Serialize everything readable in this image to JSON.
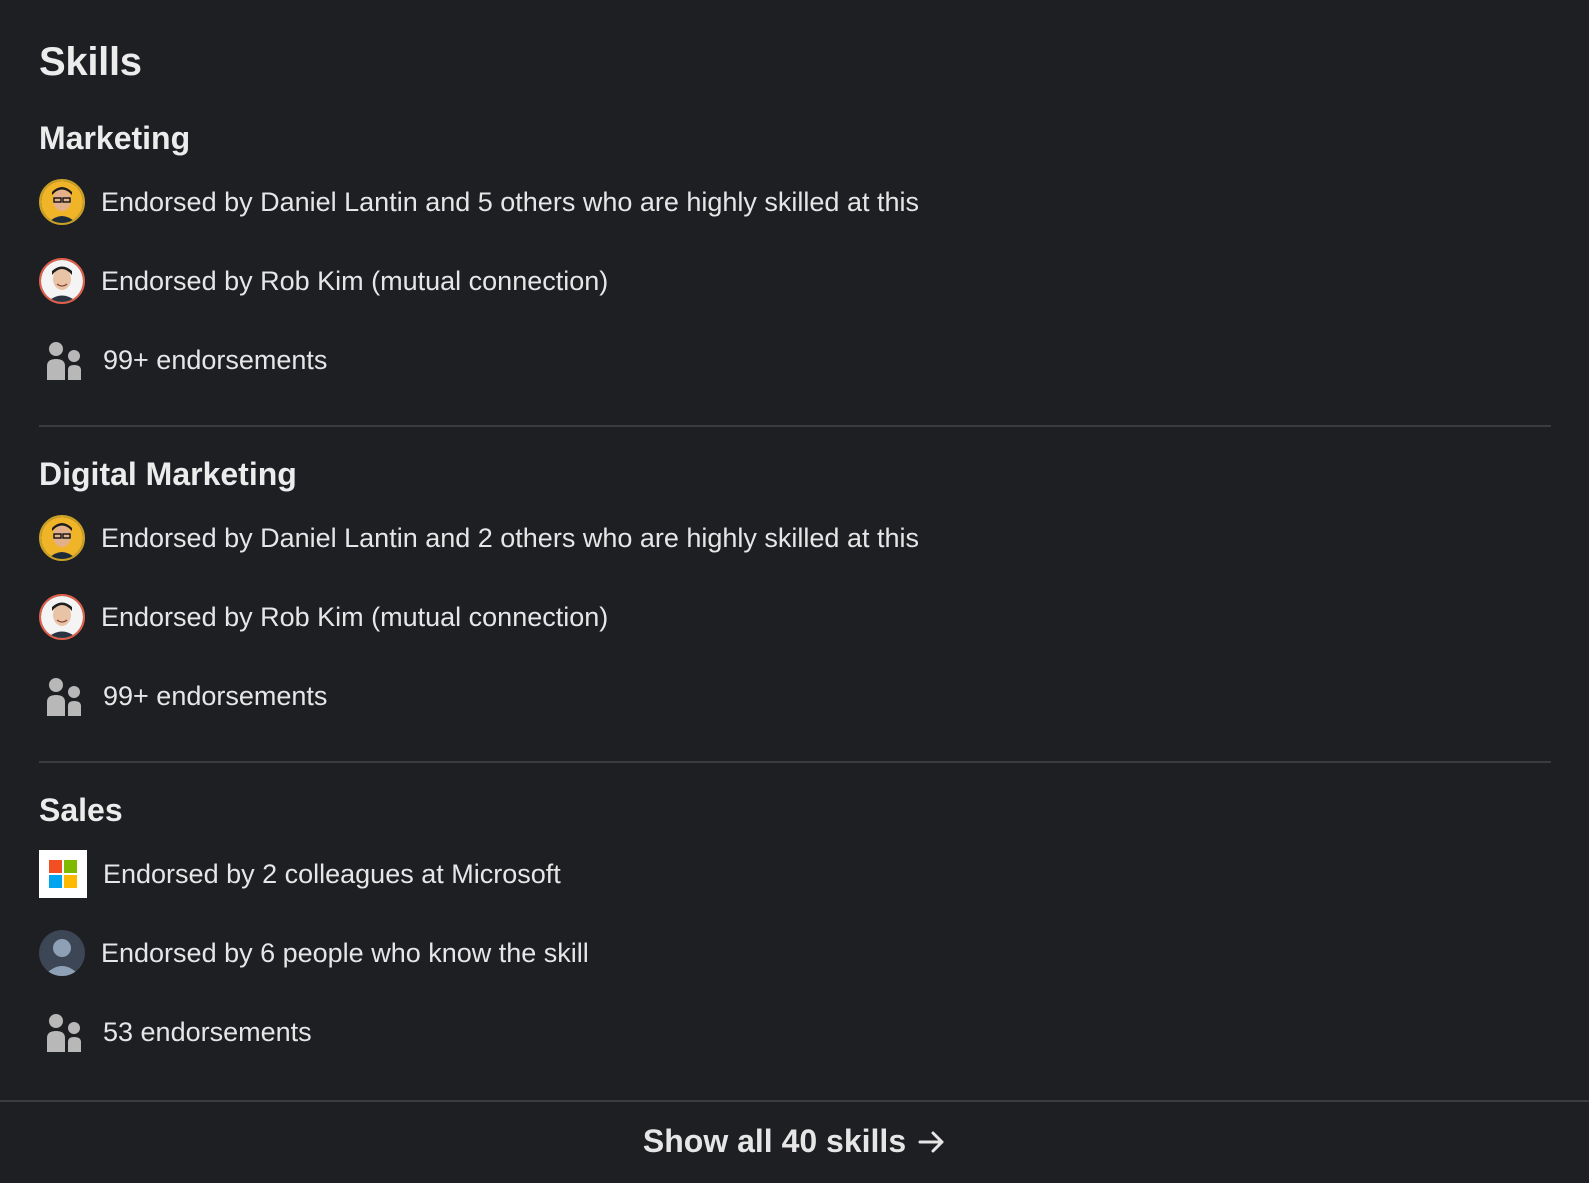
{
  "section": {
    "title": "Skills"
  },
  "skills": [
    {
      "name": "Marketing",
      "endorsements": [
        {
          "icon": "avatar-daniel-lantin",
          "text": "Endorsed by Daniel Lantin and 5 others who are highly skilled at this"
        },
        {
          "icon": "avatar-rob-kim",
          "text": "Endorsed by Rob Kim (mutual connection)"
        },
        {
          "icon": "people-icon",
          "text": "99+ endorsements"
        }
      ]
    },
    {
      "name": "Digital Marketing",
      "endorsements": [
        {
          "icon": "avatar-daniel-lantin",
          "text": "Endorsed by Daniel Lantin and 2 others who are highly skilled at this"
        },
        {
          "icon": "avatar-rob-kim",
          "text": "Endorsed by Rob Kim (mutual connection)"
        },
        {
          "icon": "people-icon",
          "text": "99+ endorsements"
        }
      ]
    },
    {
      "name": "Sales",
      "endorsements": [
        {
          "icon": "microsoft-logo-icon",
          "text": "Endorsed by 2 colleagues at Microsoft"
        },
        {
          "icon": "default-avatar-icon",
          "text": "Endorsed by 6 people who know the skill"
        },
        {
          "icon": "people-icon",
          "text": "53 endorsements"
        }
      ]
    }
  ],
  "footer": {
    "show_all_label": "Show all 40 skills",
    "arrow_icon": "arrow-right-icon"
  },
  "colors": {
    "background": "#1d1f23",
    "text": "#e6e6e6",
    "divider": "#3a3c40",
    "icon_gray": "#b8b8b8",
    "ms_red": "#f25022",
    "ms_green": "#7fba00",
    "ms_blue": "#00a4ef",
    "ms_yellow": "#ffb900"
  }
}
